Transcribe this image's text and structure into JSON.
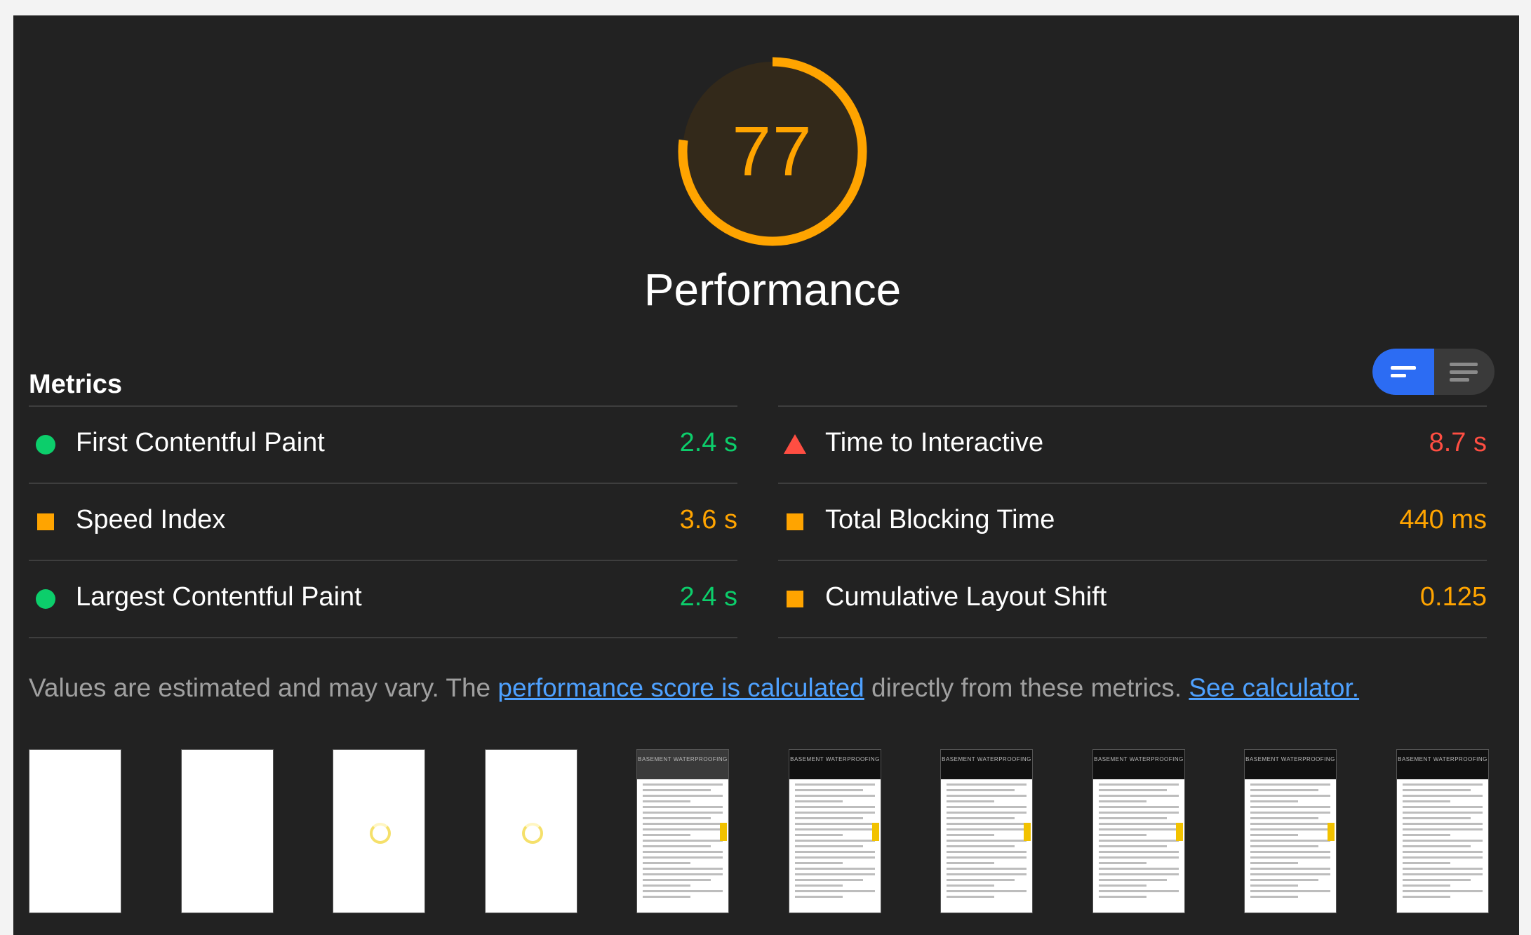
{
  "gauge": {
    "score": "77",
    "fraction": 0.77,
    "title": "Performance",
    "color": "#ffa400"
  },
  "metrics": {
    "title": "Metrics",
    "left": [
      {
        "label": "First Contentful Paint",
        "value": "2.4 s",
        "status": "pass",
        "icon": "green-circle-icon",
        "color": "#0cce6b"
      },
      {
        "label": "Speed Index",
        "value": "3.6 s",
        "status": "average",
        "icon": "orange-square-icon",
        "color": "#ffa400"
      },
      {
        "label": "Largest Contentful Paint",
        "value": "2.4 s",
        "status": "pass",
        "icon": "green-circle-icon",
        "color": "#0cce6b"
      }
    ],
    "right": [
      {
        "label": "Time to Interactive",
        "value": "8.7 s",
        "status": "fail",
        "icon": "red-triangle-icon",
        "color": "#ff4e42"
      },
      {
        "label": "Total Blocking Time",
        "value": "440 ms",
        "status": "average",
        "icon": "orange-square-icon",
        "color": "#ffa400"
      },
      {
        "label": "Cumulative Layout Shift",
        "value": "0.125",
        "status": "average",
        "icon": "orange-square-icon",
        "color": "#ffa400"
      }
    ],
    "view_toggle": {
      "selected": "summary-view-icon",
      "other": "list-view-icon"
    }
  },
  "note": {
    "prefix": "Values are estimated and may vary. The ",
    "link1": "performance score is calculated",
    "middle": " directly from these metrics. ",
    "link2": "See calculator."
  },
  "filmstrip": {
    "frames": [
      {
        "state": "blank"
      },
      {
        "state": "blank"
      },
      {
        "state": "loading"
      },
      {
        "state": "loading"
      },
      {
        "state": "content",
        "header": "BASEMENT WATERPROOFING"
      },
      {
        "state": "content",
        "header": "BASEMENT WATERPROOFING"
      },
      {
        "state": "content",
        "header": "BASEMENT WATERPROOFING"
      },
      {
        "state": "content",
        "header": "BASEMENT WATERPROOFING"
      },
      {
        "state": "content",
        "header": "BASEMENT WATERPROOFING"
      },
      {
        "state": "content",
        "header": "BASEMENT WATERPROOFING"
      }
    ]
  }
}
